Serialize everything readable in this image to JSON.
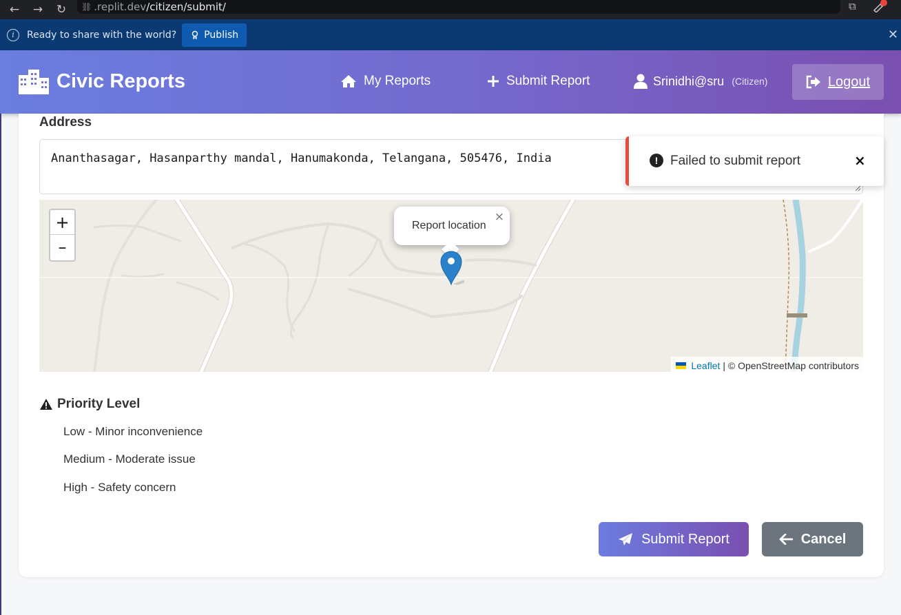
{
  "browser": {
    "url_host": ".replit.dev",
    "url_path": "/citizen/submit/"
  },
  "banner": {
    "text": "Ready to share with the world?",
    "publish_label": "Publish"
  },
  "header": {
    "brand": "Civic Reports",
    "nav": {
      "my_reports": "My Reports",
      "submit_report": "Submit Report"
    },
    "user": "Srinidhi@sru",
    "role": "(Citizen)",
    "logout": "Logout"
  },
  "form": {
    "address_label": "Address",
    "address_value": "Ananthasagar, Hasanparthy mandal, Hanumakonda, Telangana, 505476, India"
  },
  "map": {
    "zoom_in": "+",
    "zoom_out": "–",
    "popup_text": "Report location",
    "popup_close": "×",
    "attribution_link": "Leaflet",
    "attribution_text": "| © OpenStreetMap contributors"
  },
  "toast": {
    "message": "Failed to submit report",
    "close": "×",
    "accent_color": "#e84c3d"
  },
  "priority": {
    "heading": "Priority Level",
    "options": [
      "Low - Minor inconvenience",
      "Medium - Moderate issue",
      "High - Safety concern"
    ]
  },
  "actions": {
    "submit": "Submit Report",
    "cancel": "Cancel"
  },
  "colors": {
    "header_start": "#6a7ee0",
    "header_end": "#7a4fb0",
    "banner_bg": "#0b3a73",
    "cancel_bg": "#6c757d"
  }
}
